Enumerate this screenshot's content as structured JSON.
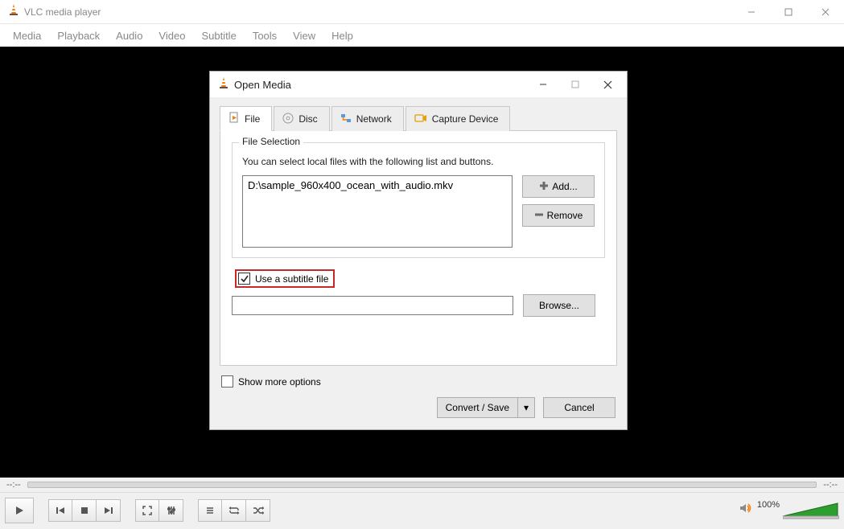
{
  "app": {
    "title": "VLC media player"
  },
  "menu": {
    "items": [
      "Media",
      "Playback",
      "Audio",
      "Video",
      "Subtitle",
      "Tools",
      "View",
      "Help"
    ]
  },
  "seek": {
    "left": "--:--",
    "right": "--:--"
  },
  "volume": {
    "percent": "100%"
  },
  "dialog": {
    "title": "Open Media",
    "tabs": [
      {
        "id": "file",
        "label": "File",
        "active": true
      },
      {
        "id": "disc",
        "label": "Disc",
        "active": false
      },
      {
        "id": "network",
        "label": "Network",
        "active": false
      },
      {
        "id": "capture",
        "label": "Capture Device",
        "active": false
      }
    ],
    "file_selection": {
      "legend": "File Selection",
      "hint": "You can select local files with the following list and buttons.",
      "files": [
        "D:\\sample_960x400_ocean_with_audio.mkv"
      ],
      "add_label": "Add...",
      "remove_label": "Remove"
    },
    "subtitle": {
      "checkbox_label": "Use a subtitle file",
      "checked": true,
      "path": "",
      "browse_label": "Browse..."
    },
    "more_options": {
      "label": "Show more options",
      "checked": false
    },
    "buttons": {
      "primary": "Convert / Save",
      "cancel": "Cancel"
    }
  }
}
